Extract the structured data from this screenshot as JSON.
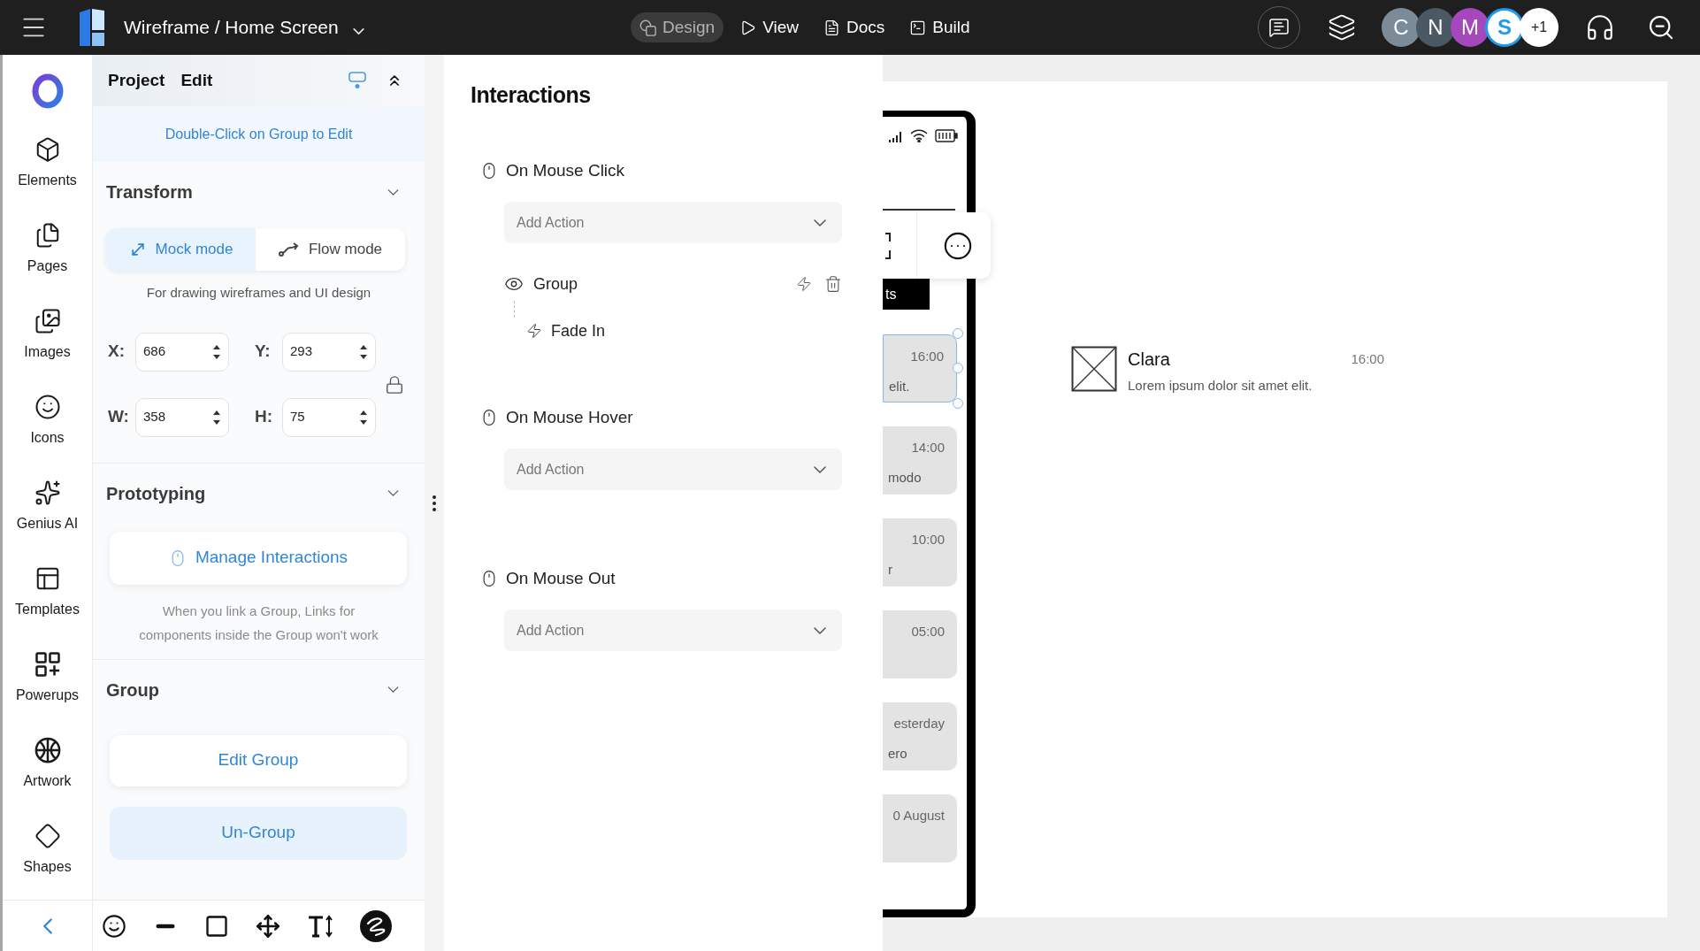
{
  "top_bar": {
    "title": "Wireframe / Home Screen",
    "modes": [
      {
        "label": "Design",
        "selected": true
      },
      {
        "label": "View",
        "selected": false
      },
      {
        "label": "Docs",
        "selected": false
      },
      {
        "label": "Build",
        "selected": false
      }
    ],
    "avatars": [
      {
        "letter": "C",
        "kind": "initial",
        "color": "#7b8c98"
      },
      {
        "letter": "N",
        "kind": "initial",
        "color": "#4a5963"
      },
      {
        "letter": "M",
        "kind": "initial",
        "color": "#a448bb"
      },
      {
        "letter": "S",
        "kind": "logo",
        "color": "#1e9be9"
      }
    ],
    "more_count": "+1"
  },
  "rail": {
    "items": [
      {
        "label": "Elements"
      },
      {
        "label": "Pages"
      },
      {
        "label": "Images"
      },
      {
        "label": "Icons"
      },
      {
        "label": "Genius AI"
      },
      {
        "label": "Templates"
      },
      {
        "label": "Powerups"
      },
      {
        "label": "Artwork"
      },
      {
        "label": "Shapes"
      }
    ]
  },
  "properties": {
    "tabs": [
      "Project",
      "Edit"
    ],
    "hint": "Double-Click on Group to Edit",
    "transform": {
      "title": "Transform",
      "modes": [
        {
          "label": "Mock mode",
          "selected": true
        },
        {
          "label": "Flow mode",
          "selected": false
        }
      ],
      "caption": "For drawing wireframes and UI design",
      "fields": [
        {
          "label": "X:",
          "value": "686"
        },
        {
          "label": "Y:",
          "value": "293"
        },
        {
          "label": "W:",
          "value": "358"
        },
        {
          "label": "H:",
          "value": "75"
        }
      ]
    },
    "prototyping": {
      "title": "Prototyping",
      "button": "Manage Interactions",
      "note": "When you link a Group, Links for components inside the Group won't work"
    },
    "group": {
      "title": "Group",
      "buttons": [
        {
          "label": "Edit Group",
          "kind": "plain"
        },
        {
          "label": "Un-Group",
          "kind": "tinted"
        }
      ]
    }
  },
  "interactions": {
    "title": "Interactions",
    "events": [
      {
        "label": "On Mouse Click",
        "placeholder": "Add Action",
        "actions": [
          {
            "target": "Group",
            "children": [
              {
                "label": "Fade In"
              }
            ]
          }
        ]
      },
      {
        "label": "On Mouse Hover",
        "placeholder": "Add Action"
      },
      {
        "label": "On Mouse Out",
        "placeholder": "Add Action"
      }
    ]
  },
  "canvas": {
    "phone": {
      "tab": "ts",
      "cards": [
        {
          "stamp": "16:00",
          "preview": "elit.",
          "selected": true
        },
        {
          "stamp": "14:00",
          "preview": "modo",
          "selected": false
        },
        {
          "stamp": "10:00",
          "preview": "r",
          "selected": false
        },
        {
          "stamp": "05:00",
          "selected": false
        },
        {
          "stamp": "esterday",
          "preview": "ero",
          "selected": false
        },
        {
          "stamp": "0 August",
          "selected": false
        }
      ]
    },
    "item": {
      "name": "Clara",
      "time": "16:00",
      "message": "Lorem ipsum dolor sit amet elit."
    }
  }
}
